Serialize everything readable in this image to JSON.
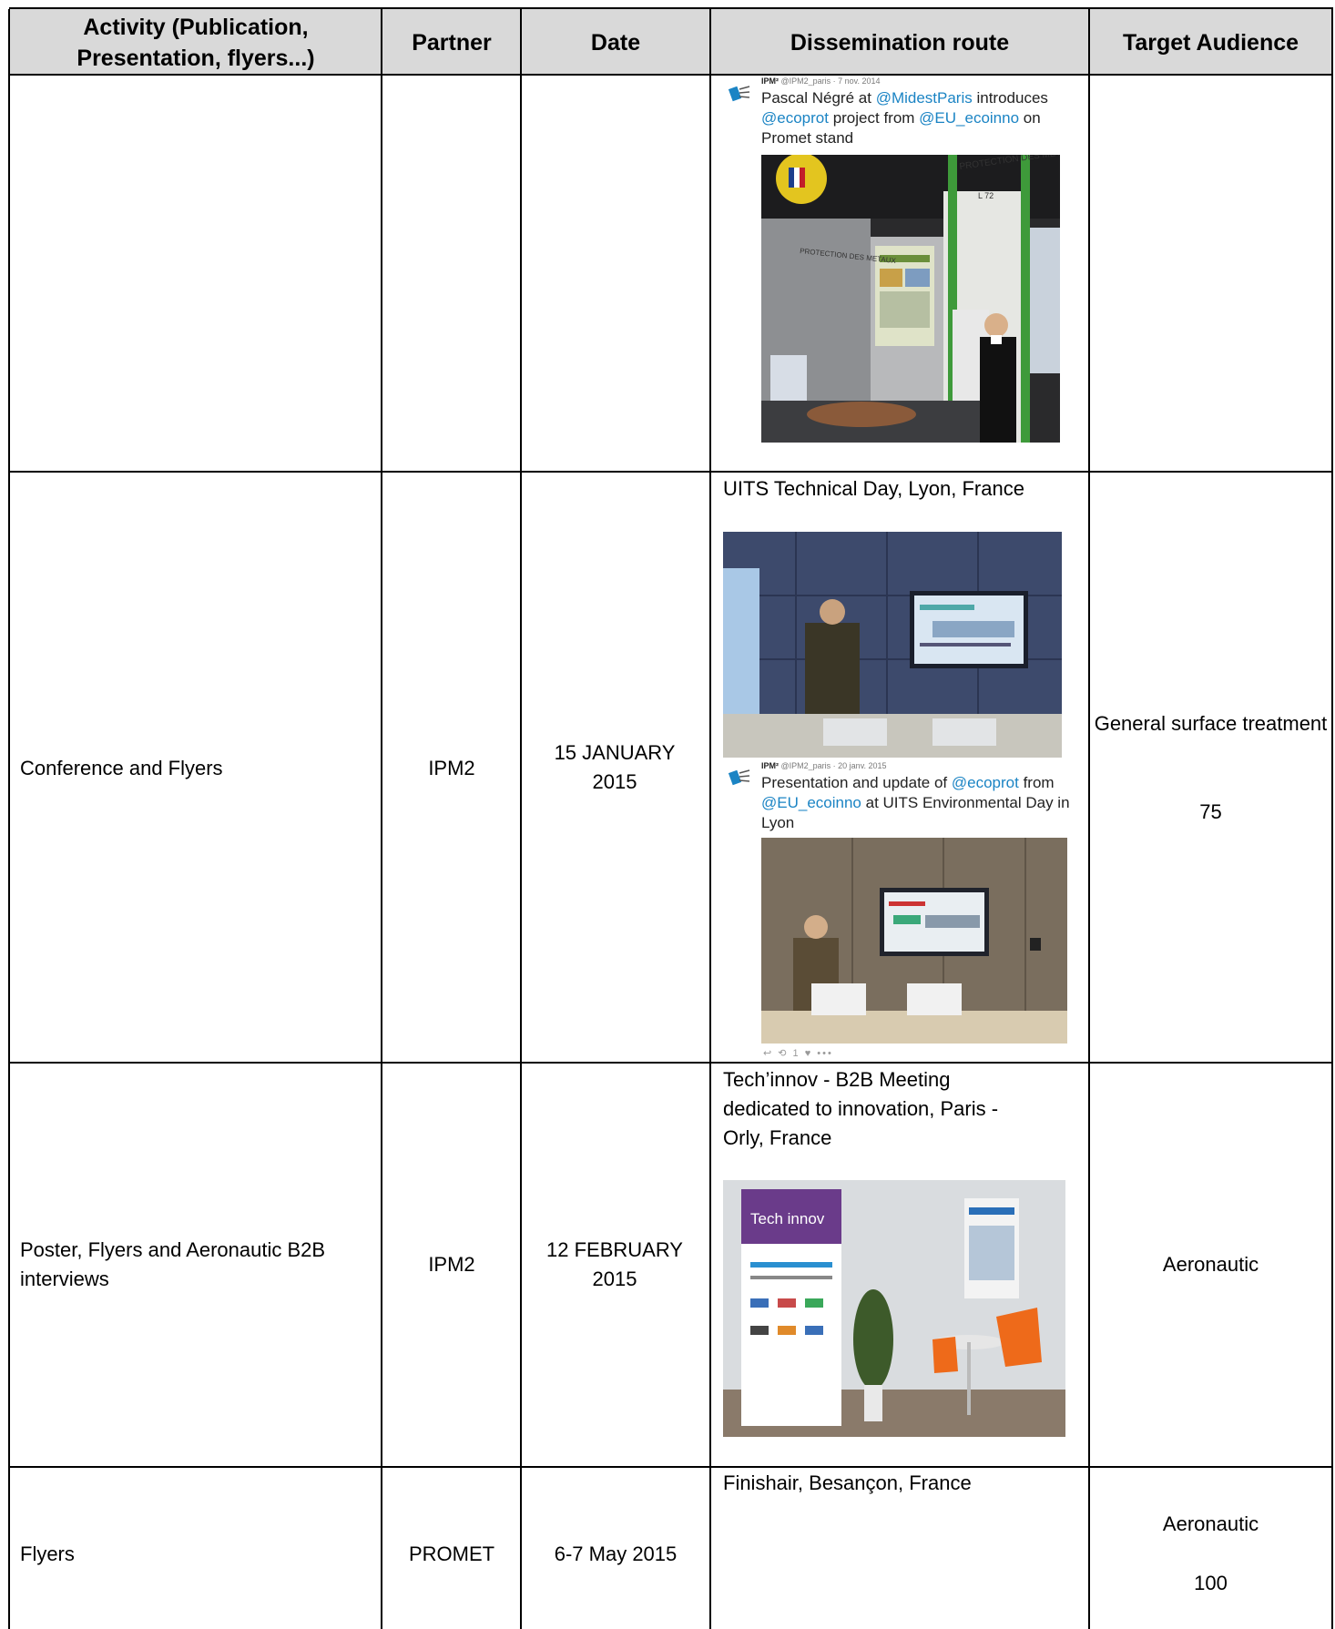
{
  "headers": {
    "activity": "Activity (Publication, Presentation, flyers...)",
    "partner": "Partner",
    "date": "Date",
    "route": "Dissemination route",
    "audience": "Target Audience"
  },
  "row1": {
    "tweet": {
      "handle": "IPM²",
      "meta": "@IPM2_paris · 7 nov. 2014",
      "t1": "Pascal Négré at ",
      "tag1": "@MidestParis",
      "t2": " introduces ",
      "tag2": "@ecoprot",
      "t3": " project from ",
      "tag3": "@EU_ecoinno",
      "t4": " on Promet stand"
    },
    "photo_labels": {
      "a": "PROTECTION DES METAUX",
      "b": "L 72",
      "c": "PROTECTION DES METAUX"
    }
  },
  "row2": {
    "activity": "Conference and Flyers",
    "partner": "IPM2",
    "date": "15 JANUARY 2015",
    "route_title": "UITS Technical Day, Lyon, France",
    "tweet": {
      "handle": "IPM²",
      "meta": "@IPM2_paris · 20 janv. 2015",
      "t1": "Presentation and update of ",
      "tag1": "@ecoprot",
      "t2": " from ",
      "tag2": "@EU_ecoinno",
      "t3": " at UITS Environmental Day in Lyon"
    },
    "tweet_footer": "↩  ⟲ 1  ♥  •••",
    "audience": "General surface treatment",
    "audience_count": "75"
  },
  "row3": {
    "activity": "Poster, Flyers and Aeronautic B2B interviews",
    "partner": "IPM2",
    "date": "12 FEBRUARY 2015",
    "route_title": "Tech’innov - B2B Meeting dedicated to innovation, Paris - Orly, France",
    "photo_banner": "Tech innov",
    "audience": "Aeronautic"
  },
  "row4": {
    "activity": "Flyers",
    "partner": "PROMET",
    "date": "6-7 May 2015",
    "route_title": "Finishair, Besançon, France",
    "audience": "Aeronautic",
    "audience_count": "100"
  }
}
